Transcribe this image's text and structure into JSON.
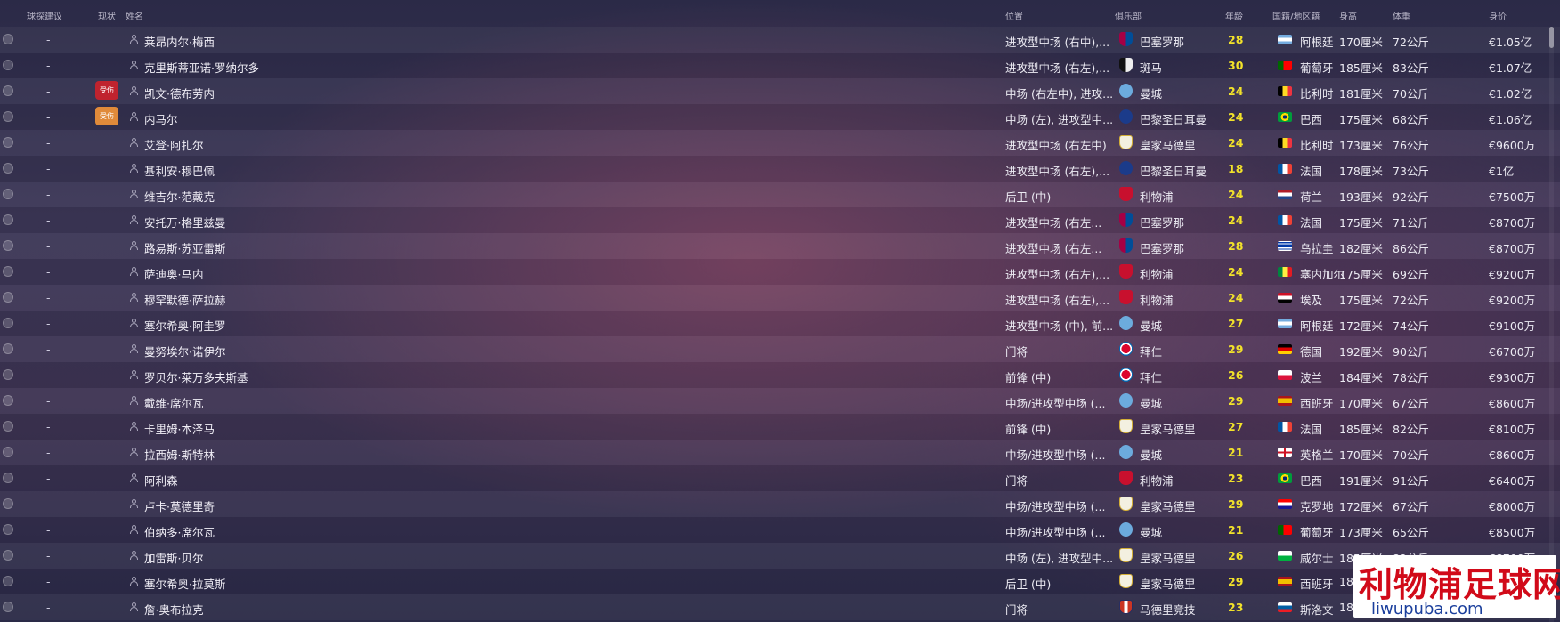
{
  "header": {
    "scout_advice": "球探建议",
    "status": "现状",
    "name": "姓名",
    "position": "位置",
    "club": "俱乐部",
    "age": "年龄",
    "nationality": "国籍/地区籍",
    "height": "身高",
    "weight": "体重",
    "value": "身价"
  },
  "colors": {
    "injury_red": "#c0232e",
    "injury_orange": "#e08a3a",
    "age_yellow": "#f2e22a",
    "watermark_red": "#d10a19",
    "watermark_blue": "#1a3e9c"
  },
  "players": [
    {
      "scout": "-",
      "status": "",
      "name": "莱昂内尔·梅西",
      "position": "进攻型中场 (右中),...",
      "club": "巴塞罗那",
      "club_icon": "barcelona-crest-icon",
      "age": "28",
      "nationality": "阿根廷",
      "flag_icon": "argentina-flag-icon",
      "height": "170厘米",
      "weight": "72公斤",
      "value": "€1.05亿"
    },
    {
      "scout": "-",
      "status": "",
      "name": "克里斯蒂亚诺·罗纳尔多",
      "position": "进攻型中场 (右左),...",
      "club": "斑马",
      "club_icon": "juventus-crest-icon",
      "age": "30",
      "nationality": "葡萄牙",
      "flag_icon": "portugal-flag-icon",
      "height": "185厘米",
      "weight": "83公斤",
      "value": "€1.07亿"
    },
    {
      "scout": "-",
      "status": "受伤",
      "status_color": "red",
      "name": "凯文·德布劳内",
      "position": "中场 (右左中), 进攻...",
      "club": "曼城",
      "club_icon": "man-city-crest-icon",
      "age": "24",
      "nationality": "比利时",
      "flag_icon": "belgium-flag-icon",
      "height": "181厘米",
      "weight": "70公斤",
      "value": "€1.02亿"
    },
    {
      "scout": "-",
      "status": "受伤",
      "status_color": "orange",
      "name": "内马尔",
      "position": "中场 (左), 进攻型中...",
      "club": "巴黎圣日耳曼",
      "club_icon": "psg-crest-icon",
      "age": "24",
      "nationality": "巴西",
      "flag_icon": "brazil-flag-icon",
      "height": "175厘米",
      "weight": "68公斤",
      "value": "€1.06亿"
    },
    {
      "scout": "-",
      "status": "",
      "name": "艾登·阿扎尔",
      "position": "进攻型中场 (右左中)",
      "club": "皇家马德里",
      "club_icon": "real-madrid-crest-icon",
      "age": "24",
      "nationality": "比利时",
      "flag_icon": "belgium-flag-icon",
      "height": "173厘米",
      "weight": "76公斤",
      "value": "€9600万"
    },
    {
      "scout": "-",
      "status": "",
      "name": "基利安·穆巴佩",
      "position": "进攻型中场 (右左),...",
      "club": "巴黎圣日耳曼",
      "club_icon": "psg-crest-icon",
      "age": "18",
      "nationality": "法国",
      "flag_icon": "france-flag-icon",
      "height": "178厘米",
      "weight": "73公斤",
      "value": "€1亿"
    },
    {
      "scout": "-",
      "status": "",
      "name": "维吉尔·范戴克",
      "position": "后卫 (中)",
      "club": "利物浦",
      "club_icon": "liverpool-crest-icon",
      "age": "24",
      "nationality": "荷兰",
      "flag_icon": "netherlands-flag-icon",
      "height": "193厘米",
      "weight": "92公斤",
      "value": "€7500万"
    },
    {
      "scout": "-",
      "status": "",
      "name": "安托万·格里兹曼",
      "position": "进攻型中场 (右左...",
      "club": "巴塞罗那",
      "club_icon": "barcelona-crest-icon",
      "age": "24",
      "nationality": "法国",
      "flag_icon": "france-flag-icon",
      "height": "175厘米",
      "weight": "71公斤",
      "value": "€8700万"
    },
    {
      "scout": "-",
      "status": "",
      "name": "路易斯·苏亚雷斯",
      "position": "进攻型中场 (右左...",
      "club": "巴塞罗那",
      "club_icon": "barcelona-crest-icon",
      "age": "28",
      "nationality": "乌拉圭",
      "flag_icon": "uruguay-flag-icon",
      "height": "182厘米",
      "weight": "86公斤",
      "value": "€8700万"
    },
    {
      "scout": "-",
      "status": "",
      "name": "萨迪奥·马内",
      "position": "进攻型中场 (右左),...",
      "club": "利物浦",
      "club_icon": "liverpool-crest-icon",
      "age": "24",
      "nationality": "塞内加尔",
      "flag_icon": "senegal-flag-icon",
      "height": "175厘米",
      "weight": "69公斤",
      "value": "€9200万"
    },
    {
      "scout": "-",
      "status": "",
      "name": "穆罕默德·萨拉赫",
      "position": "进攻型中场 (右左),...",
      "club": "利物浦",
      "club_icon": "liverpool-crest-icon",
      "age": "24",
      "nationality": "埃及",
      "flag_icon": "egypt-flag-icon",
      "height": "175厘米",
      "weight": "72公斤",
      "value": "€9200万"
    },
    {
      "scout": "-",
      "status": "",
      "name": "塞尔希奥·阿圭罗",
      "position": "进攻型中场 (中), 前...",
      "club": "曼城",
      "club_icon": "man-city-crest-icon",
      "age": "27",
      "nationality": "阿根廷",
      "flag_icon": "argentina-flag-icon",
      "height": "172厘米",
      "weight": "74公斤",
      "value": "€9100万"
    },
    {
      "scout": "-",
      "status": "",
      "name": "曼努埃尔·诺伊尔",
      "position": "门将",
      "club": "拜仁",
      "club_icon": "bayern-crest-icon",
      "age": "29",
      "nationality": "德国",
      "flag_icon": "germany-flag-icon",
      "height": "192厘米",
      "weight": "90公斤",
      "value": "€6700万"
    },
    {
      "scout": "-",
      "status": "",
      "name": "罗贝尔·莱万多夫斯基",
      "position": "前锋 (中)",
      "club": "拜仁",
      "club_icon": "bayern-crest-icon",
      "age": "26",
      "nationality": "波兰",
      "flag_icon": "poland-flag-icon",
      "height": "184厘米",
      "weight": "78公斤",
      "value": "€9300万"
    },
    {
      "scout": "-",
      "status": "",
      "name": "戴维·席尔瓦",
      "position": "中场/进攻型中场 (...",
      "club": "曼城",
      "club_icon": "man-city-crest-icon",
      "age": "29",
      "nationality": "西班牙",
      "flag_icon": "spain-flag-icon",
      "height": "170厘米",
      "weight": "67公斤",
      "value": "€8600万"
    },
    {
      "scout": "-",
      "status": "",
      "name": "卡里姆·本泽马",
      "position": "前锋 (中)",
      "club": "皇家马德里",
      "club_icon": "real-madrid-crest-icon",
      "age": "27",
      "nationality": "法国",
      "flag_icon": "france-flag-icon",
      "height": "185厘米",
      "weight": "82公斤",
      "value": "€8100万"
    },
    {
      "scout": "-",
      "status": "",
      "name": "拉西姆·斯特林",
      "position": "中场/进攻型中场 (...",
      "club": "曼城",
      "club_icon": "man-city-crest-icon",
      "age": "21",
      "nationality": "英格兰",
      "flag_icon": "england-flag-icon",
      "height": "170厘米",
      "weight": "70公斤",
      "value": "€8600万"
    },
    {
      "scout": "-",
      "status": "",
      "name": "阿利森",
      "position": "门将",
      "club": "利物浦",
      "club_icon": "liverpool-crest-icon",
      "age": "23",
      "nationality": "巴西",
      "flag_icon": "brazil-flag-icon",
      "height": "191厘米",
      "weight": "91公斤",
      "value": "€6400万"
    },
    {
      "scout": "-",
      "status": "",
      "name": "卢卡·莫德里奇",
      "position": "中场/进攻型中场 (...",
      "club": "皇家马德里",
      "club_icon": "real-madrid-crest-icon",
      "age": "29",
      "nationality": "克罗地",
      "flag_icon": "croatia-flag-icon",
      "height": "172厘米",
      "weight": "67公斤",
      "value": "€8000万"
    },
    {
      "scout": "-",
      "status": "",
      "name": "伯纳多·席尔瓦",
      "position": "中场/进攻型中场 (...",
      "club": "曼城",
      "club_icon": "man-city-crest-icon",
      "age": "21",
      "nationality": "葡萄牙",
      "flag_icon": "portugal-flag-icon",
      "height": "173厘米",
      "weight": "65公斤",
      "value": "€8500万"
    },
    {
      "scout": "-",
      "status": "",
      "name": "加雷斯·贝尔",
      "position": "中场 (左), 进攻型中...",
      "club": "皇家马德里",
      "club_icon": "real-madrid-crest-icon",
      "age": "26",
      "nationality": "威尔士",
      "flag_icon": "wales-flag-icon",
      "height": "185厘米",
      "weight": "82公斤",
      "value": "€8700万"
    },
    {
      "scout": "-",
      "status": "",
      "name": "塞尔希奥·拉莫斯",
      "position": "后卫 (中)",
      "club": "皇家马德里",
      "club_icon": "real-madrid-crest-icon",
      "age": "29",
      "nationality": "西班牙",
      "flag_icon": "spain-flag-icon",
      "height": "18",
      "weight": "",
      "value": ""
    },
    {
      "scout": "-",
      "status": "",
      "name": "詹·奥布拉克",
      "position": "门将",
      "club": "马德里竞技",
      "club_icon": "atletico-crest-icon",
      "age": "23",
      "nationality": "斯洛文",
      "flag_icon": "slovenia-flag-icon",
      "height": "18",
      "weight": "",
      "value": ""
    }
  ],
  "watermark": {
    "main": "利物浦足球网",
    "sub": "liwupuba.com"
  }
}
